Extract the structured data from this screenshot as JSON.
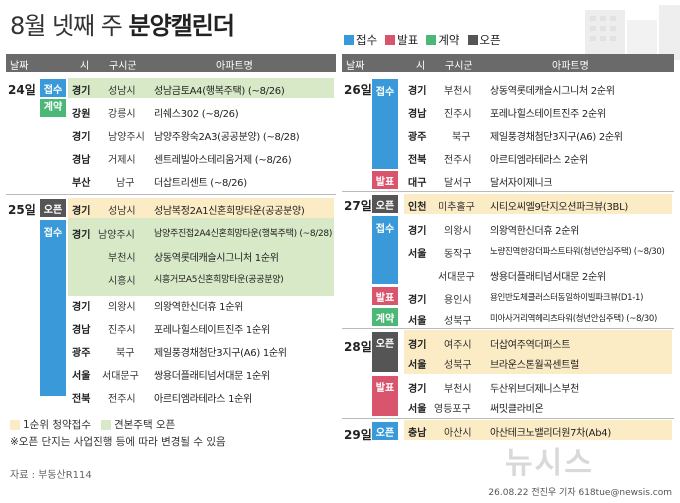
{
  "title": {
    "light": "8월 넷째 주",
    "bold": "분양캘린더"
  },
  "legend": [
    {
      "label": "접수",
      "color": "#3a9ad9"
    },
    {
      "label": "발표",
      "color": "#d9556e"
    },
    {
      "label": "계약",
      "color": "#4cb878"
    },
    {
      "label": "오픈",
      "color": "#555555"
    }
  ],
  "headers": {
    "date": "날짜",
    "prov": "시",
    "city": "구시군",
    "apt": "아파트명"
  },
  "left": {
    "dates": [
      "24일",
      "25일"
    ],
    "badges": {
      "b1": "접수",
      "b2": "계약",
      "b3": "오픈",
      "b4": "접수"
    },
    "rows": [
      {
        "prov": "경기",
        "city": "성남시",
        "apt": "성남금토A4(행복주택) (~8/26)"
      },
      {
        "prov": "강원",
        "city": "강릉시",
        "apt": "리쉐스302 (~8/26)"
      },
      {
        "prov": "경기",
        "city": "남양주시",
        "apt": "남양주왕숙2A3(공공분양) (~8/28)"
      },
      {
        "prov": "경남",
        "city": "거제시",
        "apt": "센트레빌아스테리움거제 (~8/26)"
      },
      {
        "prov": "부산",
        "city": "남구",
        "apt": "더삽트리센트 (~8/26)"
      },
      {
        "prov": "경기",
        "city": "성남시",
        "apt": "성남복정2A1신혼희망타운(공공분양)"
      },
      {
        "prov": "경기",
        "city": "남양주시",
        "apt": "남양주진접2A4신혼희망타운(행복주택) (~8/28)"
      },
      {
        "prov": "",
        "city": "부천시",
        "apt": "상동역롯데캐슬시그니처 1순위"
      },
      {
        "prov": "",
        "city": "시흥시",
        "apt": "시흥거모A5신혼희망타운(공공분양)"
      },
      {
        "prov": "경기",
        "city": "의왕시",
        "apt": "의왕역한신더휴 1순위"
      },
      {
        "prov": "경남",
        "city": "진주시",
        "apt": "포레나힐스테이트진주 1순위"
      },
      {
        "prov": "광주",
        "city": "북구",
        "apt": "제일풍경채첨단3지구(A6) 1순위"
      },
      {
        "prov": "서울",
        "city": "서대문구",
        "apt": "쌍용더플래티넘서대문 1순위"
      },
      {
        "prov": "전북",
        "city": "전주시",
        "apt": "아르티엠라테라스 1순위"
      }
    ]
  },
  "right": {
    "dates": [
      "26일",
      "27일",
      "28일",
      "29일"
    ],
    "badges": {
      "b1": "접수",
      "b2": "발표",
      "b3": "오픈",
      "b4": "접수",
      "b5": "발표",
      "b6": "계약",
      "b7": "오픈",
      "b8": "발표",
      "b9": "오픈"
    },
    "rows": [
      {
        "prov": "경기",
        "city": "부천시",
        "apt": "상동역롯데캐슬시그니처 2순위"
      },
      {
        "prov": "경남",
        "city": "진주시",
        "apt": "포레나힐스테이트진주 2순위"
      },
      {
        "prov": "광주",
        "city": "북구",
        "apt": "제일풍경채첨단3지구(A6) 2순위"
      },
      {
        "prov": "전북",
        "city": "전주시",
        "apt": "아르티엠라테라스 2순위"
      },
      {
        "prov": "대구",
        "city": "달서구",
        "apt": "달서자이제니크"
      },
      {
        "prov": "인천",
        "city": "미추홀구",
        "apt": "시티오씨엘9단지오션파크뷰(3BL)"
      },
      {
        "prov": "경기",
        "city": "의왕시",
        "apt": "의왕역한신더휴 2순위"
      },
      {
        "prov": "서울",
        "city": "동작구",
        "apt": "노량진역한강더파스트타워(청년안심주택) (~8/30)"
      },
      {
        "prov": "",
        "city": "서대문구",
        "apt": "쌍용더플래티넘서대문 2순위"
      },
      {
        "prov": "경기",
        "city": "용인시",
        "apt": "용인반도체클러스터동일하이빌파크뷰(D1-1)"
      },
      {
        "prov": "서울",
        "city": "성북구",
        "apt": "미아사거리역헤리츠타워(청년안심주택) (~8/30)"
      },
      {
        "prov": "경기",
        "city": "여주시",
        "apt": "더삽여주역더퍼스트"
      },
      {
        "prov": "서울",
        "city": "성북구",
        "apt": "브라운스톤월곡센트럴"
      },
      {
        "prov": "경기",
        "city": "부천시",
        "apt": "두산위브더제니스부천"
      },
      {
        "prov": "서울",
        "city": "영등포구",
        "apt": "써밋클라비온"
      },
      {
        "prov": "충남",
        "city": "아산시",
        "apt": "아산테크노밸리더원7차(Ab4)"
      }
    ]
  },
  "footnotes": {
    "legend_y": "1순위 청약접수",
    "legend_g": "견본주택 오픈",
    "note": "※오픈 단지는 사업진행 등에 따라 변경될 수 있음"
  },
  "source": "자료 : 부동산R114",
  "credit": "26.08.22 전진우 기자 618tue@newsis.com",
  "watermark": "뉴시스"
}
